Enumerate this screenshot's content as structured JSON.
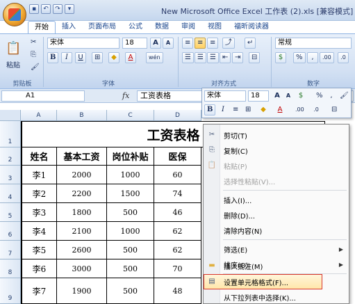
{
  "window": {
    "title": "New Microsoft Office Excel 工作表 (2).xls [兼容模式] -"
  },
  "qat": {
    "save": "▪",
    "undo": "↶",
    "redo": "↷",
    "more": "▾"
  },
  "tabs": [
    "开始",
    "插入",
    "页面布局",
    "公式",
    "数据",
    "审阅",
    "视图",
    "福昕阅读器"
  ],
  "ribbon": {
    "clipboard": {
      "paste": "粘贴",
      "label": "剪贴板"
    },
    "font": {
      "name": "宋体",
      "size": "18",
      "bold": "B",
      "italic": "I",
      "underline": "U",
      "grow": "A",
      "shrink": "A",
      "label": "字体",
      "pinyin": "wén"
    },
    "alignment": {
      "label": "对齐方式"
    },
    "number": {
      "format": "常规",
      "percent": "%",
      "comma": ",",
      "inc": ".00",
      "dec": ".0",
      "label": "数字"
    }
  },
  "formula_bar": {
    "cell_ref": "A1",
    "fx": "fx",
    "value": "工资表格"
  },
  "columns": [
    "A",
    "B",
    "C",
    "D"
  ],
  "rows": [
    "1",
    "2",
    "3",
    "4",
    "5",
    "6",
    "7",
    "8",
    "9"
  ],
  "sheet": {
    "title": "工资表格",
    "headers": [
      "姓名",
      "基本工资",
      "岗位补贴",
      "医保"
    ],
    "data": [
      [
        "李1",
        "2000",
        "1000",
        "60"
      ],
      [
        "李2",
        "2200",
        "1500",
        "74"
      ],
      [
        "李3",
        "1800",
        "500",
        "46"
      ],
      [
        "李4",
        "2100",
        "1000",
        "62"
      ],
      [
        "李5",
        "2600",
        "500",
        "62"
      ],
      [
        "李6",
        "3000",
        "500",
        "70"
      ],
      [
        "李7",
        "1900",
        "500",
        "48"
      ]
    ]
  },
  "mini_toolbar": {
    "font": "宋体",
    "size": "18",
    "bold": "B",
    "italic": "I",
    "percent": "%",
    "comma": ",",
    "inc": ".00",
    "dec": ".0"
  },
  "context_menu": {
    "items": [
      {
        "label": "剪切(T)",
        "icon": "✂"
      },
      {
        "label": "复制(C)",
        "icon": "⎘"
      },
      {
        "label": "粘贴(P)",
        "icon": "📋"
      },
      {
        "label": "选择性粘贴(V)..."
      },
      {
        "label": "插入(I)..."
      },
      {
        "label": "删除(D)..."
      },
      {
        "label": "清除内容(N)"
      },
      {
        "label": "筛选(E)",
        "arrow": "▶"
      },
      {
        "label": "排序(O)",
        "arrow": "▶"
      },
      {
        "label": "插入批注(M)",
        "icon": "▬"
      },
      {
        "label": "设置单元格格式(F)...",
        "icon": "▤"
      },
      {
        "label": "从下拉列表中选择(K)..."
      }
    ]
  }
}
